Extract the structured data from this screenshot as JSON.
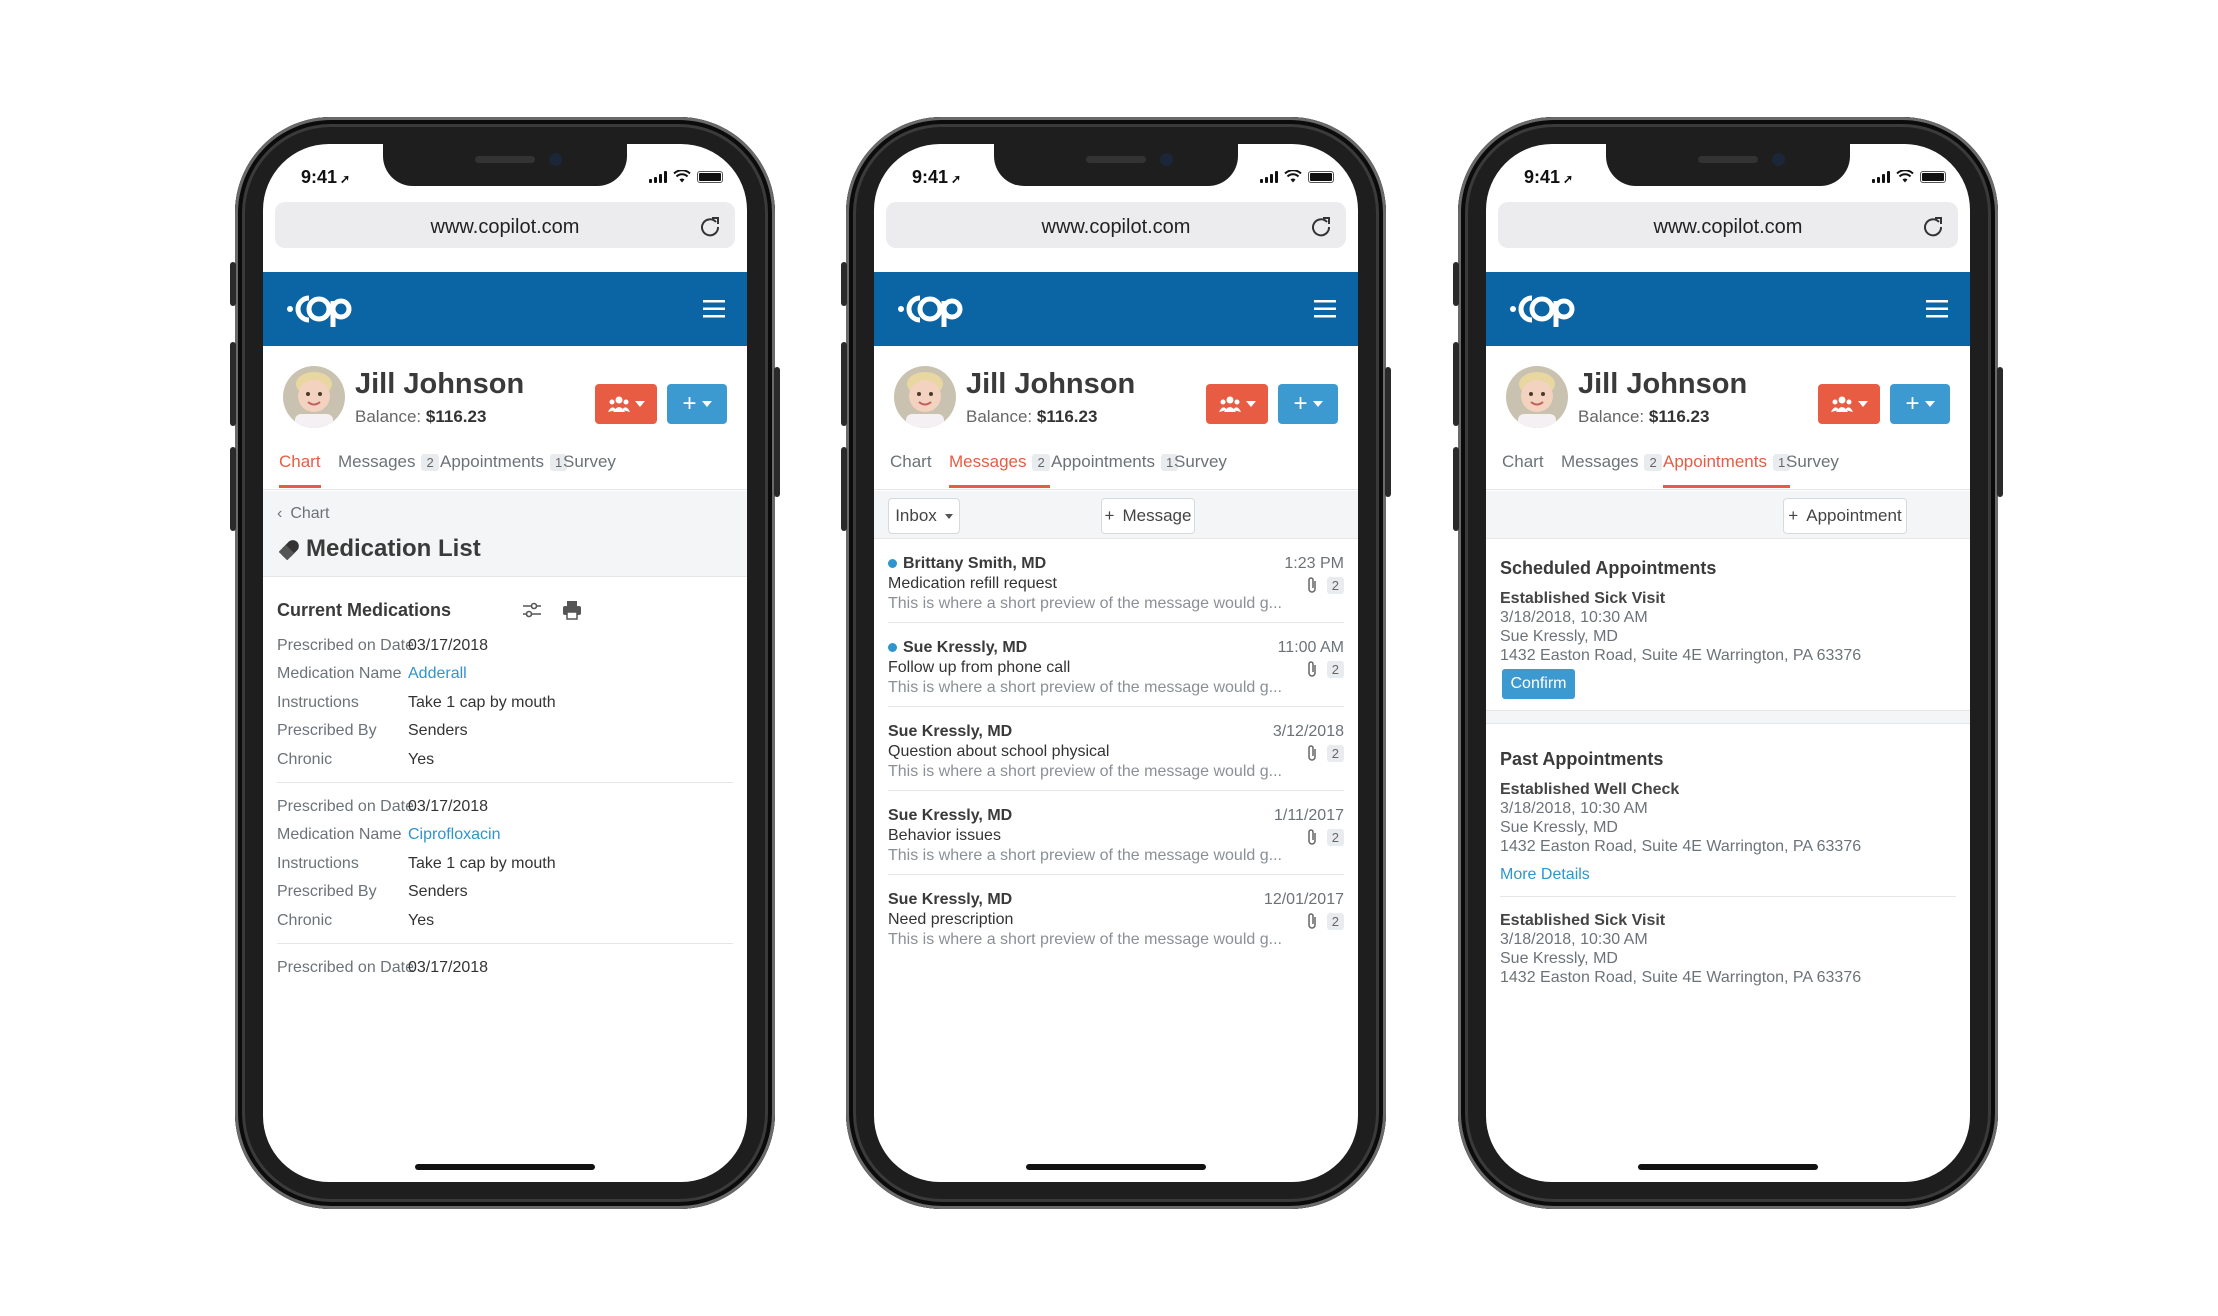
{
  "status": {
    "time": "9:41"
  },
  "browser": {
    "url": "www.copilot.com"
  },
  "patient": {
    "name": "Jill Johnson",
    "balance_label": "Balance:",
    "balance": "$116.23"
  },
  "tabs": [
    {
      "label": "Chart"
    },
    {
      "label": "Messages",
      "count": "2"
    },
    {
      "label": "Appointments",
      "count": "1"
    },
    {
      "label": "Survey"
    }
  ],
  "chart_screen": {
    "breadcrumb": "Chart",
    "title": "Medication List",
    "section_title": "Current Medications",
    "field_labels": [
      "Prescribed on Date",
      "Medication Name",
      "Instructions",
      "Prescribed By",
      "Chronic"
    ],
    "medications": [
      {
        "date": "03/17/2018",
        "name": "Adderall",
        "instructions": "Take 1 cap by mouth",
        "prescribed_by": "Senders",
        "chronic": "Yes"
      },
      {
        "date": "03/17/2018",
        "name": "Ciprofloxacin",
        "instructions": "Take 1 cap by mouth",
        "prescribed_by": "Senders",
        "chronic": "Yes"
      },
      {
        "date": "03/17/2018"
      }
    ]
  },
  "messages_screen": {
    "filter_label": "Inbox",
    "new_button": "Message",
    "messages": [
      {
        "sender": "Brittany Smith, MD",
        "time": "1:23 PM",
        "subject": "Medication refill request",
        "attachments": "2",
        "preview": "This is where a short preview of the message would g...",
        "unread": true
      },
      {
        "sender": "Sue Kressly, MD",
        "time": "11:00 AM",
        "subject": "Follow up from phone call",
        "attachments": "2",
        "preview": "This is where a short preview of the message would g...",
        "unread": true
      },
      {
        "sender": "Sue Kressly, MD",
        "time": "3/12/2018",
        "subject": "Question about school physical",
        "attachments": "2",
        "preview": "This is where a short preview of the message would g...",
        "unread": false
      },
      {
        "sender": "Sue Kressly, MD",
        "time": "1/11/2017",
        "subject": "Behavior issues",
        "attachments": "2",
        "preview": "This is where a short preview of the message would g...",
        "unread": false
      },
      {
        "sender": "Sue Kressly, MD",
        "time": "12/01/2017",
        "subject": "Need prescription",
        "attachments": "2",
        "preview": "This is where a short preview of the message would g...",
        "unread": false
      }
    ]
  },
  "appointments_screen": {
    "new_button": "Appointment",
    "scheduled_title": "Scheduled Appointments",
    "scheduled": [
      {
        "type": "Established Sick Visit",
        "datetime": "3/18/2018, 10:30 AM",
        "provider": "Sue Kressly, MD",
        "address": "1432 Easton Road, Suite 4E Warrington, PA 63376",
        "action": "Confirm"
      }
    ],
    "past_title": "Past Appointments",
    "past": [
      {
        "type": "Established Well Check",
        "datetime": "3/18/2018, 10:30 AM",
        "provider": "Sue Kressly, MD",
        "address": "1432 Easton Road, Suite 4E Warrington, PA 63376",
        "action": "More Details"
      },
      {
        "type": "Established Sick Visit",
        "datetime": "3/18/2018, 10:30 AM",
        "provider": "Sue Kressly, MD",
        "address": "1432 Easton Road, Suite 4E Warrington, PA 63376"
      }
    ]
  },
  "colors": {
    "brand_blue": "#0b65a4",
    "accent_red": "#e85c43",
    "accent_blue": "#3d9ad1",
    "link": "#2e95cf"
  },
  "icons": [
    "copilot-logo-icon",
    "hamburger-menu-icon",
    "reload-icon",
    "group-icon",
    "plus-icon",
    "chevron-left-icon",
    "pill-icon",
    "filter-icon",
    "print-icon",
    "paperclip-icon",
    "caret-down-icon"
  ]
}
